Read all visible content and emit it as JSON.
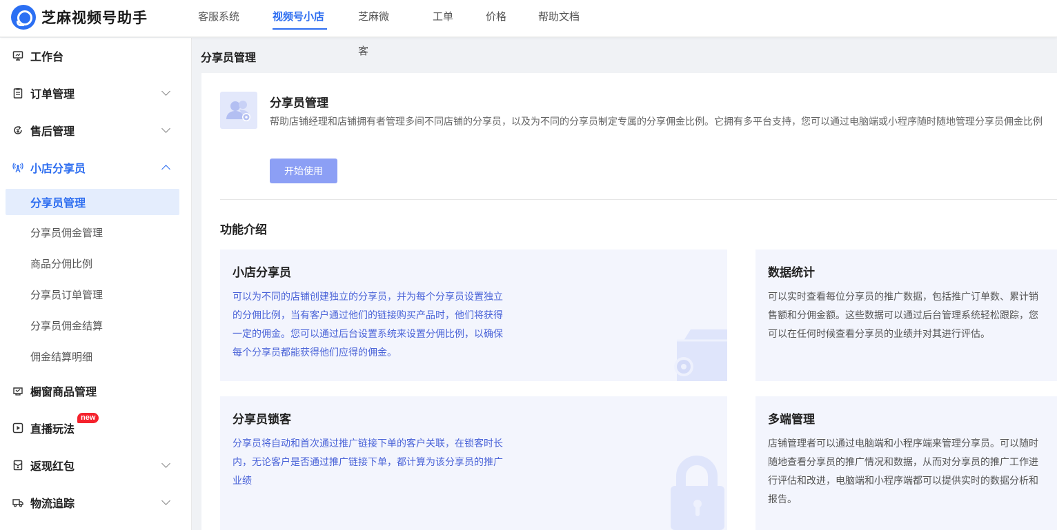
{
  "header": {
    "app_name": "芝麻视频号助手",
    "nav": [
      {
        "label": "客服系统",
        "active": false
      },
      {
        "label": "视频号小店",
        "active": true
      },
      {
        "label": "芝麻微客",
        "active": false
      },
      {
        "label": "工单",
        "active": false
      },
      {
        "label": "价格",
        "active": false
      },
      {
        "label": "帮助文档",
        "active": false
      }
    ]
  },
  "sidebar": {
    "workbench": {
      "label": "工作台",
      "icon": "monitor-icon"
    },
    "orders": {
      "label": "订单管理",
      "icon": "clipboard-icon"
    },
    "aftersale": {
      "label": "售后管理",
      "icon": "refund-icon"
    },
    "sharer": {
      "label": "小店分享员",
      "icon": "broadcast-icon",
      "children": [
        {
          "label": "分享员管理",
          "active": true
        },
        {
          "label": "分享员佣金管理"
        },
        {
          "label": "商品分佣比例"
        },
        {
          "label": "分享员订单管理"
        },
        {
          "label": "分享员佣金结算"
        },
        {
          "label": "佣金结算明细"
        }
      ]
    },
    "showcase": {
      "label": "橱窗商品管理",
      "icon": "showcase-icon"
    },
    "live": {
      "label": "直播玩法",
      "icon": "play-icon",
      "badge": "new"
    },
    "cashback": {
      "label": "返现红包",
      "icon": "red-packet-icon"
    },
    "logistics": {
      "label": "物流追踪",
      "icon": "truck-icon"
    }
  },
  "main": {
    "page_title": "分享员管理",
    "intro": {
      "title": "分享员管理",
      "description": "帮助店铺经理和店铺拥有者管理多间不同店铺的分享员，以及为不同的分享员制定专属的分享佣金比例。它拥有多平台支持，您可以通过电脑端或小程序随时随地管理分享员佣金比例",
      "start_button": "开始使用"
    },
    "section_title": "功能介绍",
    "features": [
      {
        "title": "小店分享员",
        "description": "可以为不同的店铺创建独立的分享员，并为每个分享员设置独立的分佣比例，当有客户通过他们的链接购买产品时，他们将获得一定的佣金。您可以通过后台设置系统来设置分佣比例，以确保每个分享员都能获得他们应得的佣金。"
      },
      {
        "title": "数据统计",
        "description": "可以实时查看每位分享员的推广数据，包括推广订单数、累计销售额和分佣金额。这些数据可以通过后台管理系统轻松跟踪，您可以在任何时候查看分享员的业绩并对其进行评估。"
      },
      {
        "title": "分享员锁客",
        "description": "分享员将自动和首次通过推广链接下单的客户关联，在锁客时长内，无论客户是否通过推广链接下单，都计算为该分享员的推广业绩"
      },
      {
        "title": "多端管理",
        "description": "店铺管理者可以通过电脑端和小程序端来管理分享员。可以随时随地查看分享员的推广情况和数据，从而对分享员的推广工作进行评估和改进，电脑端和小程序端都可以提供实时的数据分析和报告。"
      }
    ]
  },
  "colors": {
    "accent": "#2d6df0",
    "button": "#8c9ff5",
    "feature_bg": "#f3f5fd",
    "badge": "#f5222d"
  }
}
